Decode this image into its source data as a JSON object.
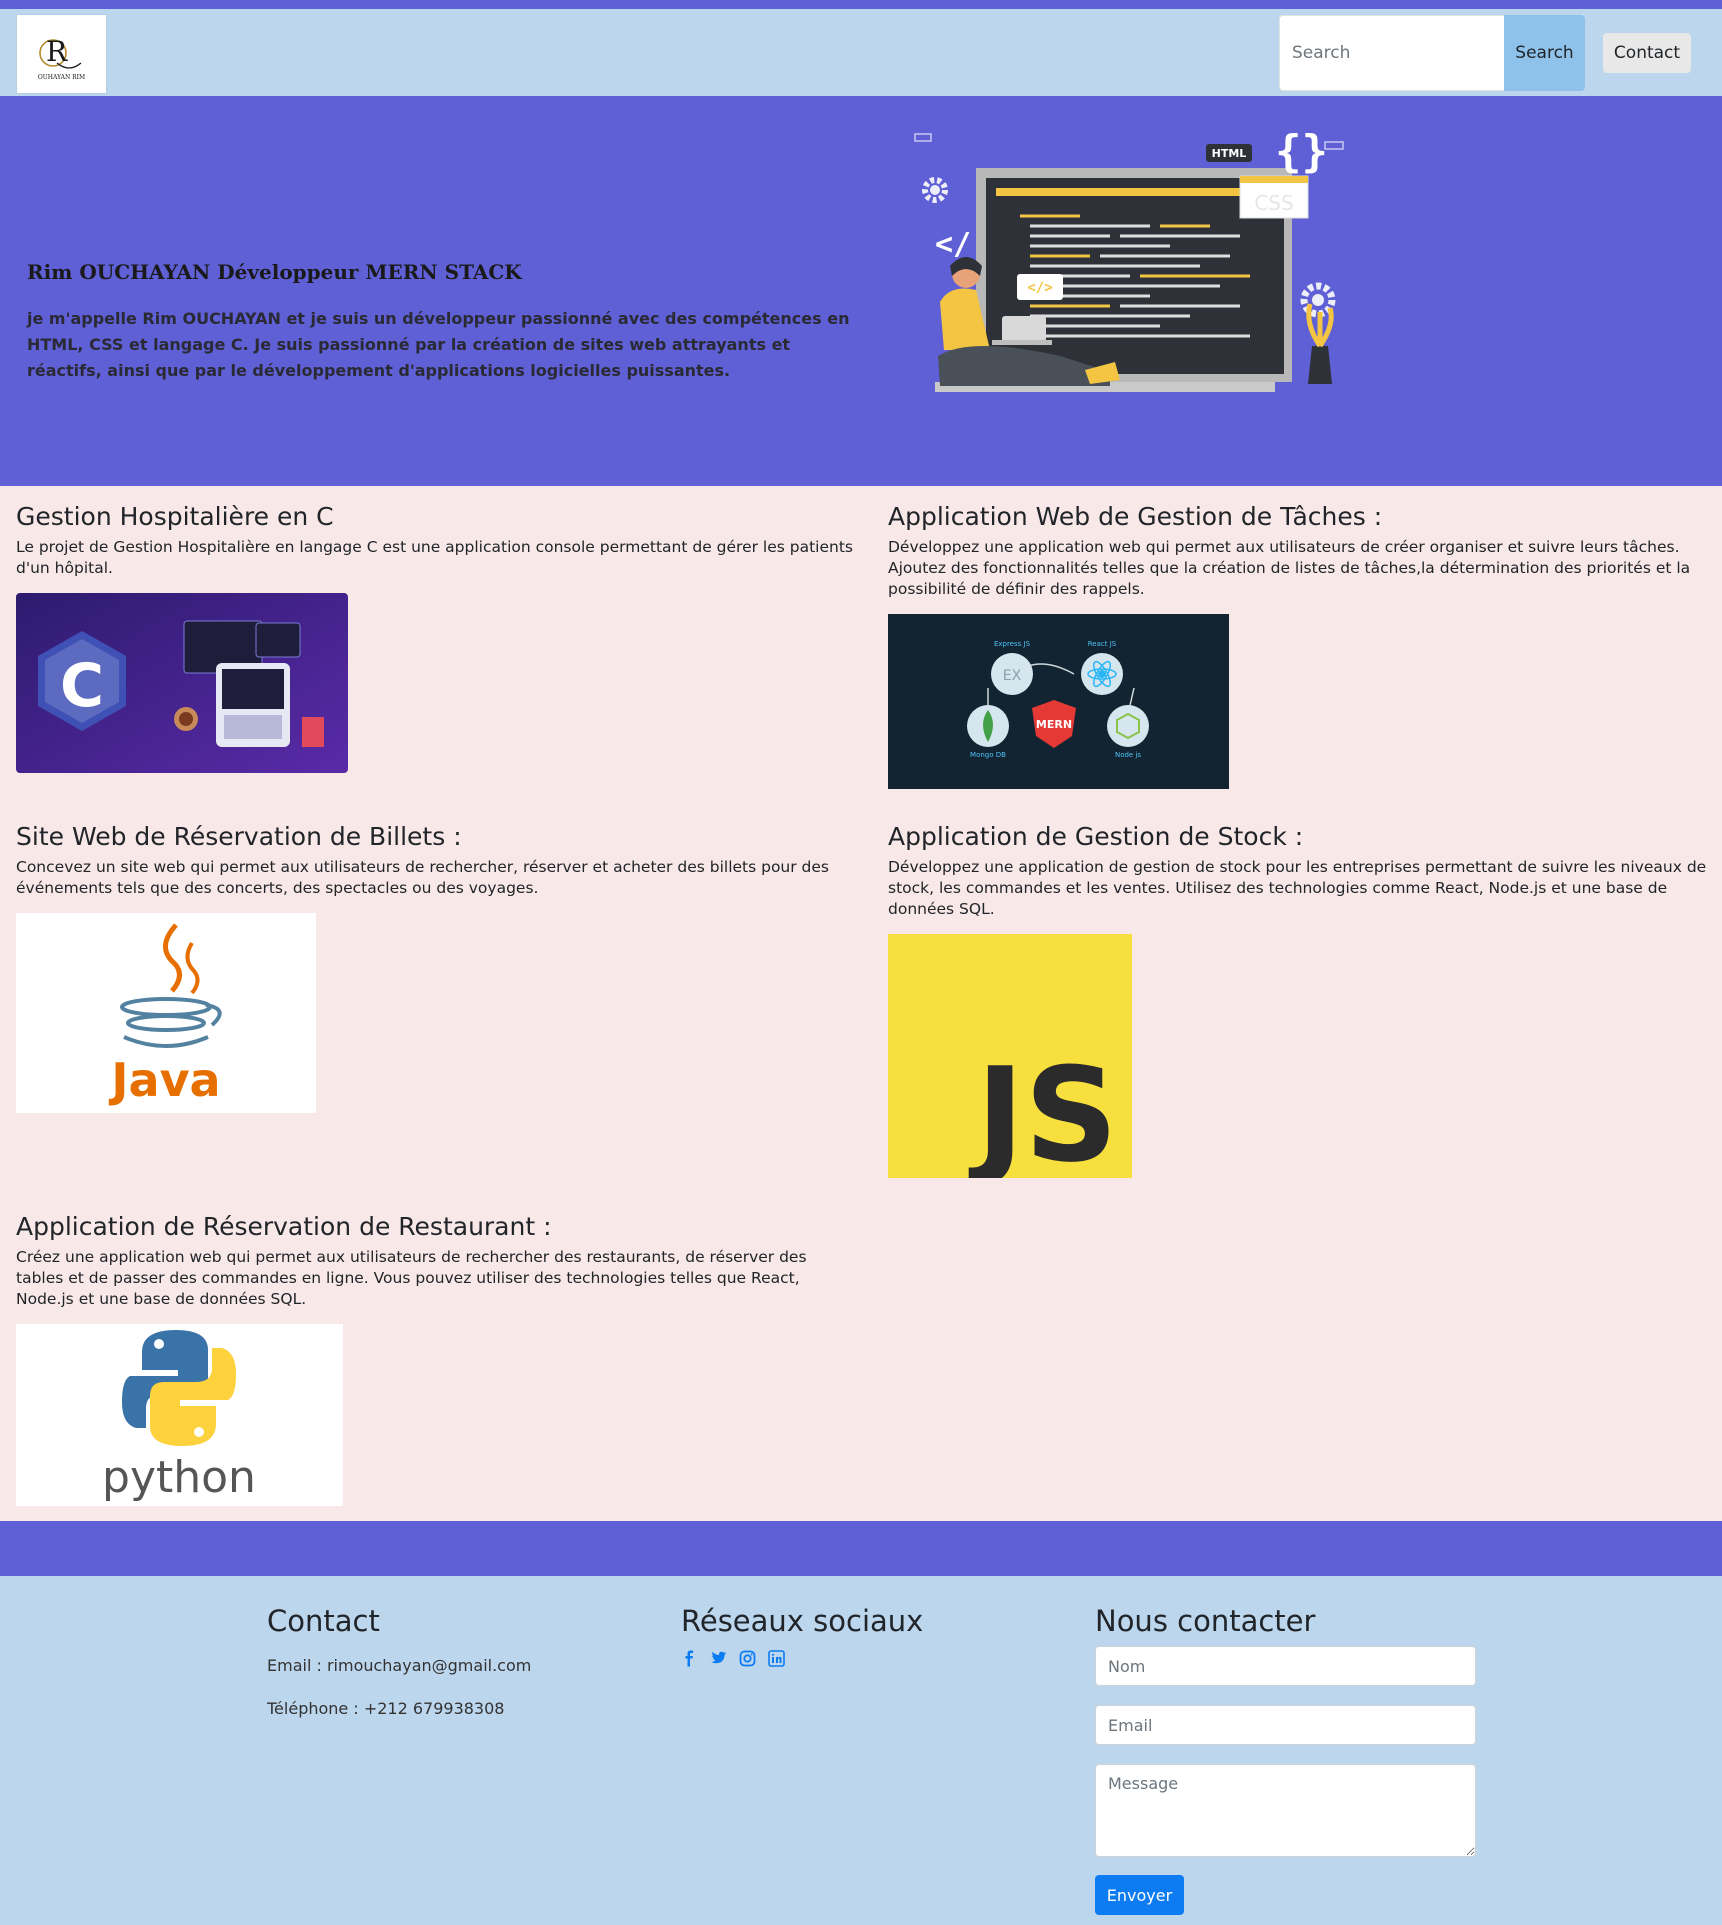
{
  "navbar": {
    "logo_initial": "R",
    "logo_text": "OUHAYAN RIM",
    "search_placeholder": "Search",
    "search_button": "Search",
    "contact_button": "Contact"
  },
  "hero": {
    "title": "Rim OUCHAYAN Développeur MERN STACK",
    "text": "je m'appelle Rim OUCHAYAN et je suis un développeur passionné avec des compétences en HTML, CSS et langage C. Je suis passionné par la création de sites web attrayants et réactifs, ainsi que par le développement d'applications logicielles puissantes.",
    "illustration_labels": {
      "html": "HTML",
      "css": "CSS",
      "code_tag": "</>"
    }
  },
  "projects": [
    {
      "title": "Gestion Hospitalière en C",
      "description": "Le projet de Gestion Hospitalière en langage C est une application console permettant de gérer les patients d'un hôpital.",
      "image_label": "C",
      "image_icon": "c-language-logo"
    },
    {
      "title": "Application Web de Gestion de Tâches :",
      "description": "Développez une application web qui permet aux utilisateurs de créer organiser et suivre leurs tâches. Ajoutez des fonctionnalités telles que la création de listes de tâches,la détermination des priorités et la possibilité de définir des rappels.",
      "image_label": "MERN",
      "image_icon": "mern-stack-diagram",
      "image_sublabels": [
        "Express JS",
        "React JS",
        "Mongo DB",
        "Node js",
        "EX"
      ]
    },
    {
      "title": "Site Web de Réservation de Billets :",
      "description": "Concevez un site web qui permet aux utilisateurs de rechercher, réserver et acheter des billets pour des événements tels que des concerts, des spectacles ou des voyages.",
      "image_label": "Java",
      "image_icon": "java-logo"
    },
    {
      "title": "Application de Gestion de Stock :",
      "description": "Développez une application de gestion de stock pour les entreprises permettant de suivre les niveaux de stock, les commandes et les ventes. Utilisez des technologies comme React, Node.js et une base de données SQL.",
      "image_label": "JS",
      "image_icon": "javascript-logo"
    },
    {
      "title": "Application de Réservation de Restaurant :",
      "description": "Créez une application web qui permet aux utilisateurs de rechercher des restaurants, de réserver des tables et de passer des commandes en ligne. Vous pouvez utiliser des technologies telles que React, Node.js et une base de données SQL.",
      "image_label": "python",
      "image_icon": "python-logo"
    }
  ],
  "footer": {
    "contact": {
      "title": "Contact",
      "email": "Email : rimouchayan@gmail.com",
      "phone": "Téléphone : +212 679938308"
    },
    "social": {
      "title": "Réseaux sociaux",
      "icons": [
        "facebook-icon",
        "twitter-icon",
        "instagram-icon",
        "linkedin-icon"
      ]
    },
    "form": {
      "title": "Nous contacter",
      "name_placeholder": "Nom",
      "email_placeholder": "Email",
      "message_placeholder": "Message",
      "submit": "Envoyer"
    }
  },
  "colors": {
    "purple": "#5f5fd6",
    "light_blue": "#bcd6ed",
    "pink_bg": "#f8e8e8",
    "search_button": "#8ec2ea",
    "send_button": "#0d7cf2",
    "social_icons": "#0d7cf2",
    "js_yellow": "#f7df3e"
  }
}
